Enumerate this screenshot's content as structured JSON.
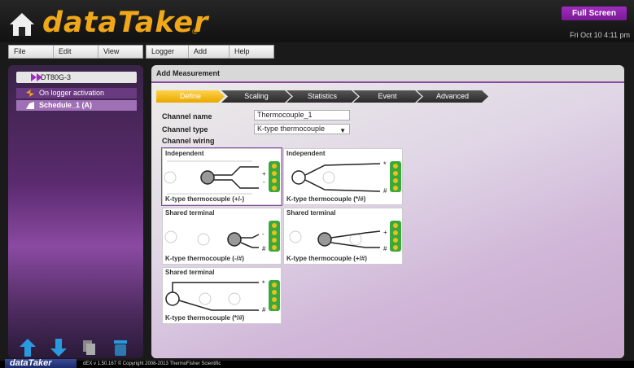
{
  "header": {
    "logo_text": "dataTaker",
    "logo_reg": "®",
    "fullscreen_label": "Full Screen",
    "datetime": "Fri Oct 10  4:11 pm",
    "accent": "#f0a818",
    "brand_purple": "#8a4aa2"
  },
  "menus": {
    "left": [
      "File",
      "Edit",
      "View"
    ],
    "right": [
      "Logger",
      "Add",
      "Help"
    ]
  },
  "sidebar": {
    "device": "DT80G-3",
    "trigger": "On logger activation",
    "schedule": "Schedule_1 (A)",
    "tools": [
      "arrow-up-icon",
      "arrow-down-icon",
      "copy-icon",
      "delete-icon"
    ]
  },
  "main": {
    "title": "Add Measurement",
    "steps": [
      "Define",
      "Scaling",
      "Statistics",
      "Event",
      "Advanced"
    ],
    "active_step": "Define",
    "channel_name_label": "Channel name",
    "channel_name_value": "Thermocouple_1",
    "channel_type_label": "Channel type",
    "channel_type_value": "K-type thermocouple",
    "channel_wiring_label": "Channel wiring",
    "wiring_options": [
      {
        "title": "Independent",
        "label": "K-type thermocouple (+/-)",
        "terminals": [
          "+",
          "-"
        ],
        "selected": true
      },
      {
        "title": "Independent",
        "label": "K-type thermocouple (*/#)",
        "terminals": [
          "*",
          "#"
        ],
        "selected": false
      },
      {
        "title": "Shared terminal",
        "label": "K-type thermocouple (-/#)",
        "terminals": [
          "-",
          "#"
        ],
        "selected": false
      },
      {
        "title": "Shared terminal",
        "label": "K-type thermocouple (+/#)",
        "terminals": [
          "+",
          "#"
        ],
        "selected": false
      },
      {
        "title": "Shared terminal",
        "label": "K-type thermocouple (*/#)",
        "terminals": [
          "*",
          "#"
        ],
        "selected": false
      }
    ]
  },
  "footer": {
    "logo": "dataTaker",
    "text": "dEX v 1.50.167  © Copyright 2008-2013 ThermoFisher Scientific"
  }
}
